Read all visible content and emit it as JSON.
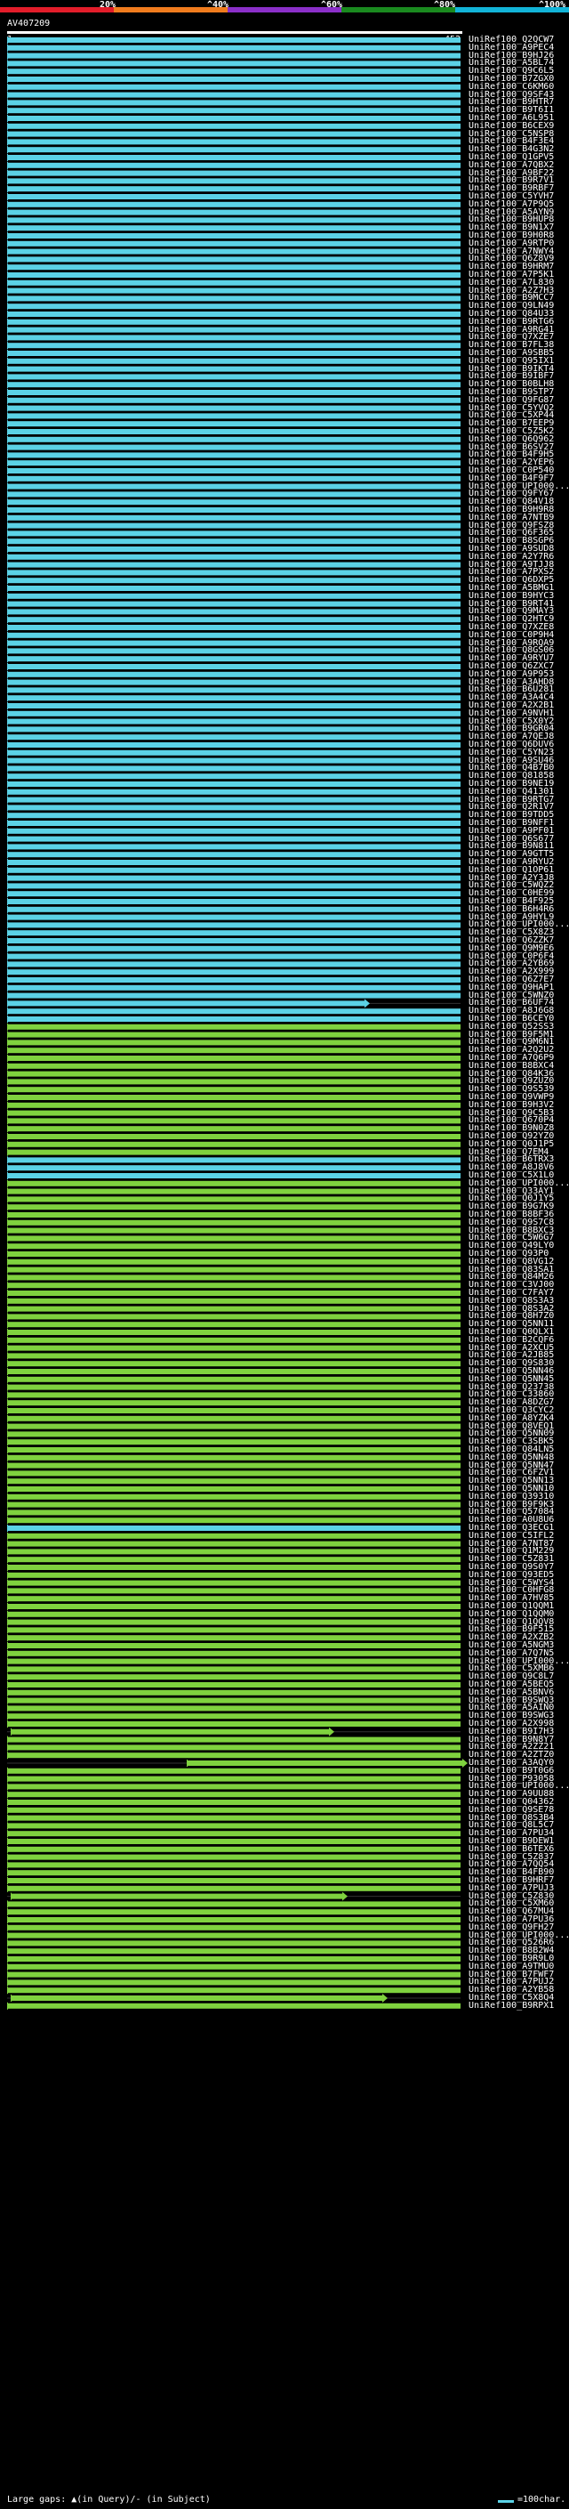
{
  "header": {
    "scale_labels": [
      "20%",
      "^40%",
      "^60%",
      "^80%",
      "^100%"
    ],
    "scale_colors": [
      "#e31d2a",
      "#f07c1e",
      "#8b2fc9",
      "#1a8a1f",
      "#12b4d8"
    ],
    "query_id": "AV407209",
    "ruler_start": "1",
    "ruler_end": "452"
  },
  "colors": {
    "cyan": "#5bd2e6",
    "green": "#7fd23e",
    "gap": "#000000"
  },
  "hits": [
    {
      "id": "UniRef100_Q2QCW7",
      "c": "cyan"
    },
    {
      "id": "UniRef100_A9PEC4",
      "c": "cyan"
    },
    {
      "id": "UniRef100_B9HJ26",
      "c": "cyan"
    },
    {
      "id": "UniRef100_A5BL74",
      "c": "cyan"
    },
    {
      "id": "UniRef100_Q9C6L5",
      "c": "cyan"
    },
    {
      "id": "UniRef100_B7ZGX0",
      "c": "cyan"
    },
    {
      "id": "UniRef100_C6KM60",
      "c": "cyan"
    },
    {
      "id": "UniRef100_Q9SF43",
      "c": "cyan"
    },
    {
      "id": "UniRef100_B9HTR7",
      "c": "cyan"
    },
    {
      "id": "UniRef100_B9T6I1",
      "c": "cyan"
    },
    {
      "id": "UniRef100_A6L951",
      "c": "cyan"
    },
    {
      "id": "UniRef100_B6CEX9",
      "c": "cyan"
    },
    {
      "id": "UniRef100_C5NSP8",
      "c": "cyan"
    },
    {
      "id": "UniRef100_B4F3E4",
      "c": "cyan"
    },
    {
      "id": "UniRef100_B4G3N2",
      "c": "cyan"
    },
    {
      "id": "UniRef100_Q1GPV5",
      "c": "cyan"
    },
    {
      "id": "UniRef100_A7QBX2",
      "c": "cyan"
    },
    {
      "id": "UniRef100_A9BF22",
      "c": "cyan"
    },
    {
      "id": "UniRef100_B9R7V1",
      "c": "cyan"
    },
    {
      "id": "UniRef100_B9RBF7",
      "c": "cyan"
    },
    {
      "id": "UniRef100_C5YVH7",
      "c": "cyan"
    },
    {
      "id": "UniRef100_A7P9Q5",
      "c": "cyan"
    },
    {
      "id": "UniRef100_A5AYN9",
      "c": "cyan"
    },
    {
      "id": "UniRef100_B9HUP8",
      "c": "cyan"
    },
    {
      "id": "UniRef100_B9N1X7",
      "c": "cyan"
    },
    {
      "id": "UniRef100_B9H0R8",
      "c": "cyan"
    },
    {
      "id": "UniRef100_A9RTP0",
      "c": "cyan"
    },
    {
      "id": "UniRef100_A7NWY4",
      "c": "cyan"
    },
    {
      "id": "UniRef100_Q6Z8V9",
      "c": "cyan"
    },
    {
      "id": "UniRef100_B9HRM7",
      "c": "cyan"
    },
    {
      "id": "UniRef100_A7P5K1",
      "c": "cyan"
    },
    {
      "id": "UniRef100_A7L830",
      "c": "cyan"
    },
    {
      "id": "UniRef100_A2Z7H3",
      "c": "cyan"
    },
    {
      "id": "UniRef100_B9MCC7",
      "c": "cyan"
    },
    {
      "id": "UniRef100_Q9LN49",
      "c": "cyan"
    },
    {
      "id": "UniRef100_Q84U33",
      "c": "cyan"
    },
    {
      "id": "UniRef100_B9RTG6",
      "c": "cyan"
    },
    {
      "id": "UniRef100_A9RG41",
      "c": "cyan"
    },
    {
      "id": "UniRef100_Q7XZE7",
      "c": "cyan"
    },
    {
      "id": "UniRef100_B7FL38",
      "c": "cyan"
    },
    {
      "id": "UniRef100_A9SBB5",
      "c": "cyan"
    },
    {
      "id": "UniRef100_Q95IX1",
      "c": "cyan"
    },
    {
      "id": "UniRef100_B9IKT4",
      "c": "cyan"
    },
    {
      "id": "UniRef100_B9IBF7",
      "c": "cyan"
    },
    {
      "id": "UniRef100_B0BLH8",
      "c": "cyan"
    },
    {
      "id": "UniRef100_B9STP7",
      "c": "cyan"
    },
    {
      "id": "UniRef100_Q9FG87",
      "c": "cyan"
    },
    {
      "id": "UniRef100_C5YVQ2",
      "c": "cyan"
    },
    {
      "id": "UniRef100_C5XP44",
      "c": "cyan"
    },
    {
      "id": "UniRef100_B7EEP9",
      "c": "cyan"
    },
    {
      "id": "UniRef100_C5Z5K2",
      "c": "cyan"
    },
    {
      "id": "UniRef100_Q6Q962",
      "c": "cyan"
    },
    {
      "id": "UniRef100_B6SV27",
      "c": "cyan"
    },
    {
      "id": "UniRef100_B4F9H5",
      "c": "cyan"
    },
    {
      "id": "UniRef100_A2YEP6",
      "c": "cyan"
    },
    {
      "id": "UniRef100_C0P540",
      "c": "cyan"
    },
    {
      "id": "UniRef100_B4F9F7",
      "c": "cyan"
    },
    {
      "id": "UniRef100_UPI000...",
      "c": "cyan"
    },
    {
      "id": "UniRef100_Q9FY67",
      "c": "cyan"
    },
    {
      "id": "UniRef100_Q84V18",
      "c": "cyan"
    },
    {
      "id": "UniRef100_B9H9R8",
      "c": "cyan"
    },
    {
      "id": "UniRef100_A7NTB9",
      "c": "cyan"
    },
    {
      "id": "UniRef100_Q9FSZ8",
      "c": "cyan"
    },
    {
      "id": "UniRef100_Q6F365",
      "c": "cyan"
    },
    {
      "id": "UniRef100_B8SGP6",
      "c": "cyan"
    },
    {
      "id": "UniRef100_A9SUD8",
      "c": "cyan"
    },
    {
      "id": "UniRef100_A2Y7R6",
      "c": "cyan"
    },
    {
      "id": "UniRef100_A9TJJ8",
      "c": "cyan"
    },
    {
      "id": "UniRef100_A7PXS2",
      "c": "cyan"
    },
    {
      "id": "UniRef100_Q6DXP5",
      "c": "cyan"
    },
    {
      "id": "UniRef100_A5BMG1",
      "c": "cyan"
    },
    {
      "id": "UniRef100_B9HYC3",
      "c": "cyan"
    },
    {
      "id": "UniRef100_B9RT41",
      "c": "cyan"
    },
    {
      "id": "UniRef100_Q9MAY3",
      "c": "cyan"
    },
    {
      "id": "UniRef100_Q2HTC9",
      "c": "cyan"
    },
    {
      "id": "UniRef100_Q7XZE8",
      "c": "cyan"
    },
    {
      "id": "UniRef100_C0P9H4",
      "c": "cyan"
    },
    {
      "id": "UniRef100_A9RQA9",
      "c": "cyan"
    },
    {
      "id": "UniRef100_Q8GS06",
      "c": "cyan"
    },
    {
      "id": "UniRef100_A9RYU7",
      "c": "cyan"
    },
    {
      "id": "UniRef100_Q6ZXC7",
      "c": "cyan"
    },
    {
      "id": "UniRef100_A9P953",
      "c": "cyan"
    },
    {
      "id": "UniRef100_A3AHD8",
      "c": "cyan"
    },
    {
      "id": "UniRef100_B6U281",
      "c": "cyan"
    },
    {
      "id": "UniRef100_A3A4C4",
      "c": "cyan"
    },
    {
      "id": "UniRef100_A2X2B1",
      "c": "cyan"
    },
    {
      "id": "UniRef100_A9NVH1",
      "c": "cyan"
    },
    {
      "id": "UniRef100_C5X0Y2",
      "c": "cyan"
    },
    {
      "id": "UniRef100_B9GR04",
      "c": "cyan"
    },
    {
      "id": "UniRef100_A7QEJ8",
      "c": "cyan"
    },
    {
      "id": "UniRef100_Q6DUV6",
      "c": "cyan"
    },
    {
      "id": "UniRef100_C5YN23",
      "c": "cyan"
    },
    {
      "id": "UniRef100_A9SU46",
      "c": "cyan"
    },
    {
      "id": "UniRef100_Q4B7B0",
      "c": "cyan"
    },
    {
      "id": "UniRef100_Q81858",
      "c": "cyan"
    },
    {
      "id": "UniRef100_B9NE19",
      "c": "cyan"
    },
    {
      "id": "UniRef100_Q41301",
      "c": "cyan"
    },
    {
      "id": "UniRef100_B9RTG7",
      "c": "cyan"
    },
    {
      "id": "UniRef100_Q2R1V7",
      "c": "cyan"
    },
    {
      "id": "UniRef100_B9TDD5",
      "c": "cyan"
    },
    {
      "id": "UniRef100_B9NFF1",
      "c": "cyan"
    },
    {
      "id": "UniRef100_A9PF01",
      "c": "cyan"
    },
    {
      "id": "UniRef100_Q6S677",
      "c": "cyan"
    },
    {
      "id": "UniRef100_B9N811",
      "c": "cyan"
    },
    {
      "id": "UniRef100_A9GTT5",
      "c": "cyan"
    },
    {
      "id": "UniRef100_A9RYU2",
      "c": "cyan"
    },
    {
      "id": "UniRef100_Q1OP61",
      "c": "cyan"
    },
    {
      "id": "UniRef100_A2Y3J8",
      "c": "cyan"
    },
    {
      "id": "UniRef100_C5WQZ2",
      "c": "cyan"
    },
    {
      "id": "UniRef100_C0HE99",
      "c": "cyan"
    },
    {
      "id": "UniRef100_B4F925",
      "c": "cyan"
    },
    {
      "id": "UniRef100_B6H4R6",
      "c": "cyan"
    },
    {
      "id": "UniRef100_A9HYL9",
      "c": "cyan"
    },
    {
      "id": "UniRef100_UPI000...",
      "c": "cyan"
    },
    {
      "id": "UniRef100_C5X8Z3",
      "c": "cyan"
    },
    {
      "id": "UniRef100_Q6ZZK7",
      "c": "cyan"
    },
    {
      "id": "UniRef100_Q9M9E6",
      "c": "cyan"
    },
    {
      "id": "UniRef100_C0P6F4",
      "c": "cyan"
    },
    {
      "id": "UniRef100_A2YB69",
      "c": "cyan"
    },
    {
      "id": "UniRef100_A2X999",
      "c": "cyan"
    },
    {
      "id": "UniRef100_Q6Z7E7",
      "c": "cyan"
    },
    {
      "id": "UniRef100_Q9HAP1",
      "c": "cyan"
    },
    {
      "id": "UniRef100_C5WNZ0",
      "c": "cyan"
    },
    {
      "id": "UniRef100_B6UF74",
      "c": "cyan"
    },
    {
      "id": "UniRef100_A8J6G8",
      "c": "cyan"
    },
    {
      "id": "UniRef100_B6CEY0",
      "c": "cyan"
    },
    {
      "id": "UniRef100_Q52SS3",
      "c": "green"
    },
    {
      "id": "UniRef100_B9F5M1",
      "c": "green"
    },
    {
      "id": "UniRef100_Q9M6N1",
      "c": "green"
    },
    {
      "id": "UniRef100_A2Q2U2",
      "c": "green"
    },
    {
      "id": "UniRef100_A7Q6P9",
      "c": "green"
    },
    {
      "id": "UniRef100_B8BXC4",
      "c": "green"
    },
    {
      "id": "UniRef100_Q84K36",
      "c": "green"
    },
    {
      "id": "UniRef100_Q9ZUZ0",
      "c": "green"
    },
    {
      "id": "UniRef100_Q9S539",
      "c": "green"
    },
    {
      "id": "UniRef100_Q9VWP9",
      "c": "green"
    },
    {
      "id": "UniRef100_B9H3V2",
      "c": "green"
    },
    {
      "id": "UniRef100_Q9C5B3",
      "c": "green"
    },
    {
      "id": "UniRef100_Q670P4",
      "c": "green"
    },
    {
      "id": "UniRef100_B9N0Z8",
      "c": "green"
    },
    {
      "id": "UniRef100_Q92YZ0",
      "c": "green"
    },
    {
      "id": "UniRef100_Q0J1P5",
      "c": "green"
    },
    {
      "id": "UniRef100_Q7EM4",
      "c": "green"
    },
    {
      "id": "UniRef100_B6TRX3",
      "c": "cyan"
    },
    {
      "id": "UniRef100_A8J8V6",
      "c": "cyan"
    },
    {
      "id": "UniRef100_C5X1L0",
      "c": "cyan"
    },
    {
      "id": "UniRef100_UPI000...",
      "c": "green"
    },
    {
      "id": "UniRef100_Q33AY1",
      "c": "green"
    },
    {
      "id": "UniRef100_Q0J1Y5",
      "c": "green"
    },
    {
      "id": "UniRef100_B9G7K9",
      "c": "green"
    },
    {
      "id": "UniRef100_B8BF36",
      "c": "green"
    },
    {
      "id": "UniRef100_Q9S7C8",
      "c": "green"
    },
    {
      "id": "UniRef100_B8BXC3",
      "c": "green"
    },
    {
      "id": "UniRef100_C5W6G7",
      "c": "green"
    },
    {
      "id": "UniRef100_Q49LY0",
      "c": "green"
    },
    {
      "id": "UniRef100_Q93P0",
      "c": "green"
    },
    {
      "id": "UniRef100_Q8VG12",
      "c": "green"
    },
    {
      "id": "UniRef100_Q83SA1",
      "c": "green"
    },
    {
      "id": "UniRef100_Q84M26",
      "c": "green"
    },
    {
      "id": "UniRef100_C3VJ00",
      "c": "green"
    },
    {
      "id": "UniRef100_C7FAY7",
      "c": "green"
    },
    {
      "id": "UniRef100_Q8S3A3",
      "c": "green"
    },
    {
      "id": "UniRef100_Q8S3A2",
      "c": "green"
    },
    {
      "id": "UniRef100_Q8H7Z0",
      "c": "green"
    },
    {
      "id": "UniRef100_Q5NN11",
      "c": "green"
    },
    {
      "id": "UniRef100_Q0QLX1",
      "c": "green"
    },
    {
      "id": "UniRef100_B2CQF6",
      "c": "green"
    },
    {
      "id": "UniRef100_A2XCU5",
      "c": "green"
    },
    {
      "id": "UniRef100_A2JB85",
      "c": "green"
    },
    {
      "id": "UniRef100_Q9S830",
      "c": "green"
    },
    {
      "id": "UniRef100_Q5NN46",
      "c": "green"
    },
    {
      "id": "UniRef100_Q5NN45",
      "c": "green"
    },
    {
      "id": "UniRef100_Q23738",
      "c": "green"
    },
    {
      "id": "UniRef100_C33860",
      "c": "green"
    },
    {
      "id": "UniRef100_A8DZG7",
      "c": "green"
    },
    {
      "id": "UniRef100_Q3CYC2",
      "c": "green"
    },
    {
      "id": "UniRef100_A8YZK4",
      "c": "green"
    },
    {
      "id": "UniRef100_Q8VEQ1",
      "c": "green"
    },
    {
      "id": "UniRef100_Q5NN09",
      "c": "green"
    },
    {
      "id": "UniRef100_C3SBK5",
      "c": "green"
    },
    {
      "id": "UniRef100_Q84LN5",
      "c": "green"
    },
    {
      "id": "UniRef100_Q5NN48",
      "c": "green"
    },
    {
      "id": "UniRef100_Q5NN47",
      "c": "green"
    },
    {
      "id": "UniRef100_C6FZV1",
      "c": "green"
    },
    {
      "id": "UniRef100_Q5NN13",
      "c": "green"
    },
    {
      "id": "UniRef100_Q5NN10",
      "c": "green"
    },
    {
      "id": "UniRef100_Q39310",
      "c": "green"
    },
    {
      "id": "UniRef100_B9F9K3",
      "c": "green"
    },
    {
      "id": "UniRef100_Q57084",
      "c": "green"
    },
    {
      "id": "UniRef100_A0U8U6",
      "c": "green"
    },
    {
      "id": "UniRef100_Q3ECG1",
      "c": "cyan"
    },
    {
      "id": "UniRef100_C5IFL2",
      "c": "green"
    },
    {
      "id": "UniRef100_A7NT87",
      "c": "green"
    },
    {
      "id": "UniRef100_Q1M229",
      "c": "green"
    },
    {
      "id": "UniRef100_C5Z831",
      "c": "green"
    },
    {
      "id": "UniRef100_Q9S0Y7",
      "c": "green"
    },
    {
      "id": "UniRef100_Q93ED5",
      "c": "green"
    },
    {
      "id": "UniRef100_C5WYS4",
      "c": "green"
    },
    {
      "id": "UniRef100_C0HFG8",
      "c": "green"
    },
    {
      "id": "UniRef100_A7HV85",
      "c": "green"
    },
    {
      "id": "UniRef100_Q1QQM1",
      "c": "green"
    },
    {
      "id": "UniRef100_Q1QQM0",
      "c": "green"
    },
    {
      "id": "UniRef100_Q1QQV8",
      "c": "green"
    },
    {
      "id": "UniRef100_B9F515",
      "c": "green"
    },
    {
      "id": "UniRef100_A2XZB2",
      "c": "green"
    },
    {
      "id": "UniRef100_A5NGM3",
      "c": "green"
    },
    {
      "id": "UniRef100_A7Q7N5",
      "c": "green"
    },
    {
      "id": "UniRef100_UPI000...",
      "c": "green"
    },
    {
      "id": "UniRef100_C5XMB6",
      "c": "green"
    },
    {
      "id": "UniRef100_Q9C8L7",
      "c": "green"
    },
    {
      "id": "UniRef100_A5BEQ5",
      "c": "green"
    },
    {
      "id": "UniRef100_A5BNV6",
      "c": "green"
    },
    {
      "id": "UniRef100_B9SWQ3",
      "c": "green"
    },
    {
      "id": "UniRef100_A5AIN0",
      "c": "green"
    },
    {
      "id": "UniRef100_B9SWG3",
      "c": "green"
    },
    {
      "id": "UniRef100_A2X998",
      "c": "green"
    },
    {
      "id": "UniRef100_B9I7H3",
      "c": "green"
    },
    {
      "id": "UniRef100_B9N8Y7",
      "c": "green"
    },
    {
      "id": "UniRef100_A2ZZ21",
      "c": "green"
    },
    {
      "id": "UniRef100_A2ZTZ0",
      "c": "green"
    },
    {
      "id": "UniRef100_A3AQY0",
      "c": "green"
    },
    {
      "id": "UniRef100_B9T0G6",
      "c": "green"
    },
    {
      "id": "UniRef100_P93058",
      "c": "green"
    },
    {
      "id": "UniRef100_UPI000...",
      "c": "green"
    },
    {
      "id": "UniRef100_A9UU88",
      "c": "green"
    },
    {
      "id": "UniRef100_Q04362",
      "c": "green"
    },
    {
      "id": "UniRef100_Q9SE78",
      "c": "green"
    },
    {
      "id": "UniRef100_Q8S3B4",
      "c": "green"
    },
    {
      "id": "UniRef100_Q8L5C7",
      "c": "green"
    },
    {
      "id": "UniRef100_A7PU34",
      "c": "green"
    },
    {
      "id": "UniRef100_B9DEW1",
      "c": "green"
    },
    {
      "id": "UniRef100_B6TEX6",
      "c": "green"
    },
    {
      "id": "UniRef100_C5Z837",
      "c": "green"
    },
    {
      "id": "UniRef100_A7QQ54",
      "c": "green"
    },
    {
      "id": "UniRef100_B4FB90",
      "c": "green"
    },
    {
      "id": "UniRef100_B9HRF7",
      "c": "green"
    },
    {
      "id": "UniRef100_A7PUJ3",
      "c": "green"
    },
    {
      "id": "UniRef100_C5Z830",
      "c": "green"
    },
    {
      "id": "UniRef100_C5XM60",
      "c": "green"
    },
    {
      "id": "UniRef100_Q67MU4",
      "c": "green"
    },
    {
      "id": "UniRef100_A7PU36",
      "c": "green"
    },
    {
      "id": "UniRef100_Q9FH27",
      "c": "green"
    },
    {
      "id": "UniRef100_UPI000...",
      "c": "green"
    },
    {
      "id": "UniRef100_Q526R6",
      "c": "green"
    },
    {
      "id": "UniRef100_B8B2W4",
      "c": "green"
    },
    {
      "id": "UniRef100_B9R9L0",
      "c": "green"
    },
    {
      "id": "UniRef100_A9TMU0",
      "c": "green"
    },
    {
      "id": "UniRef100_B7FWF7",
      "c": "green"
    },
    {
      "id": "UniRef100_A7PUJ2",
      "c": "green"
    },
    {
      "id": "UniRef100_A2YB58",
      "c": "green"
    },
    {
      "id": "UniRef100_C5X8Q4",
      "c": "green"
    },
    {
      "id": "UniRef100_B9RPX1",
      "c": "green"
    }
  ],
  "special_bars": {
    "123": {
      "end": 410,
      "arrow": true
    },
    "216": {
      "start": 12,
      "end": 370,
      "arrow": true
    },
    "220": {
      "start": 210,
      "end": 520,
      "arrow": true
    },
    "237": {
      "start": 12,
      "end": 385,
      "arrow": true
    },
    "250": {
      "start": 12,
      "end": 430,
      "arrow": true
    }
  },
  "footer": {
    "legend_text": "Large gaps: ▲(in Query)/- (in Subject)",
    "scale_text": "=100char."
  }
}
